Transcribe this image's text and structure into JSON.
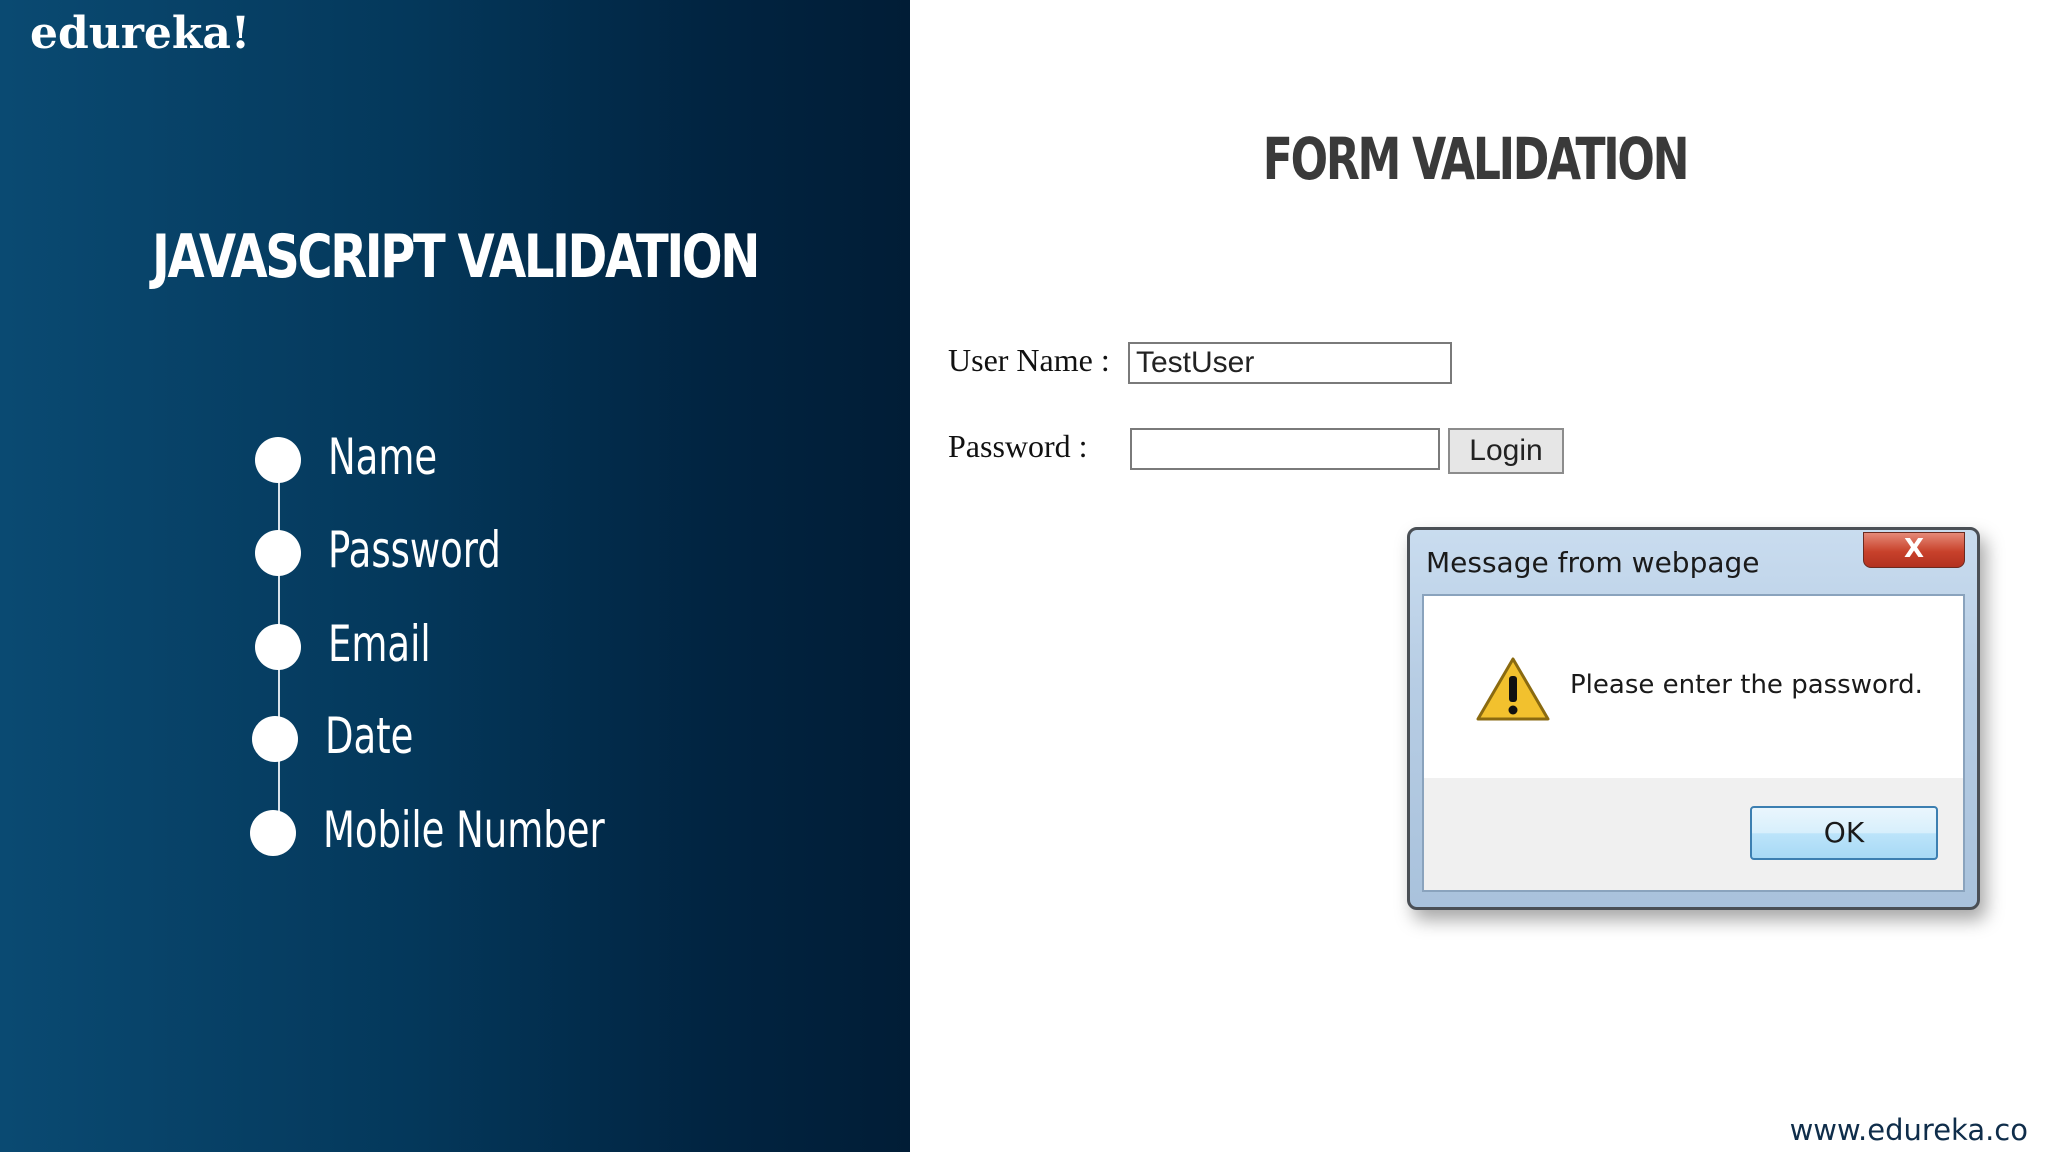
{
  "brand": {
    "logo": "edureka!",
    "website": "www.edureka.co"
  },
  "left": {
    "title": "JAVASCRIPT VALIDATION",
    "topics": [
      "Name",
      "Password",
      "Email",
      "Date",
      "Mobile Number"
    ]
  },
  "right": {
    "title": "FORM VALIDATION"
  },
  "form": {
    "username_label": "User Name :",
    "username_value": "TestUser",
    "password_label": "Password :",
    "password_value": "",
    "login_label": "Login"
  },
  "dialog": {
    "title": "Message from webpage",
    "close_glyph": "X",
    "message": "Please enter the password.",
    "ok_label": "OK",
    "icon": "warning-icon"
  },
  "colors": {
    "panel_dark": "#011d36",
    "panel_light": "#0a4a72",
    "warning_yellow": "#f2c12e"
  }
}
